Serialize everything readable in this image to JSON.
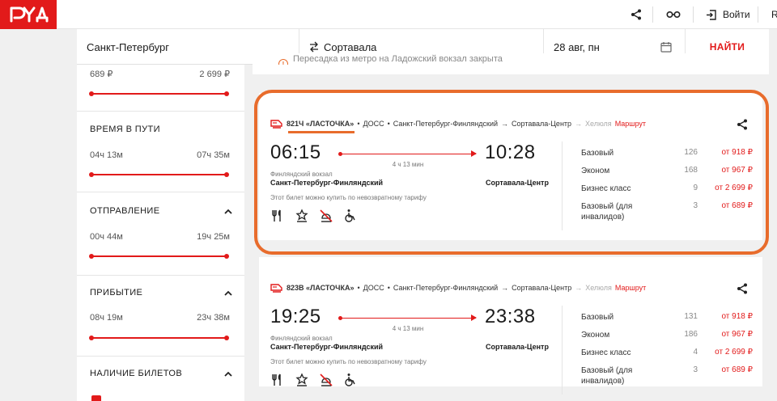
{
  "header": {
    "logo_text": "РЖД",
    "login_label": "Войти",
    "overflow_letter": "R"
  },
  "search": {
    "from": "Санкт-Петербург",
    "to": "Сортавала",
    "date": "28 авг, пн",
    "find_label": "НАЙТИ"
  },
  "filters": {
    "price": {
      "min": "689 ₽",
      "max": "2 699 ₽"
    },
    "travel_time": {
      "title": "ВРЕМЯ В ПУТИ",
      "min": "04ч 13м",
      "max": "07ч 35м"
    },
    "departure": {
      "title": "ОТПРАВЛЕНИЕ",
      "min": "00ч 44м",
      "max": "19ч 25м"
    },
    "arrival": {
      "title": "ПРИБЫТИЕ",
      "min": "08ч 19м",
      "max": "23ч 38м"
    },
    "availability": {
      "title": "НАЛИЧИЕ БИЛЕТОВ"
    }
  },
  "notice": "Пересадка из метро на Ладожский вокзал закрыта",
  "trains": [
    {
      "number": "821Ч «ЛАСТОЧКА»",
      "carrier": "ДОСС",
      "route_from": "Санкт-Петербург-Финляндский",
      "arrow": "→",
      "route_to": "Сортавала-Центр",
      "extra_arrow": "→",
      "extra_stop": "Хелюля",
      "route_link": "Маршрут",
      "dot": "•",
      "dep_time": "06:15",
      "arr_time": "10:28",
      "duration": "4 ч 13 мин",
      "dep_station_sub": "Финляндский вокзал",
      "dep_station": "Санкт-Петербург-Финляндский",
      "arr_station": "Сортавала-Центр",
      "tariff_note": "Этот билет можно купить по невозвратному тарифу",
      "classes": [
        {
          "name": "Базовый",
          "count": "126",
          "price": "от 918 ₽"
        },
        {
          "name": "Эконом",
          "count": "168",
          "price": "от 967 ₽"
        },
        {
          "name": "Бизнес класс",
          "count": "9",
          "price": "от 2 699 ₽"
        },
        {
          "name": "Базовый (для инвалидов)",
          "count": "3",
          "price": "от 689 ₽"
        }
      ]
    },
    {
      "number": "823В «ЛАСТОЧКА»",
      "carrier": "ДОСС",
      "route_from": "Санкт-Петербург-Финляндский",
      "arrow": "→",
      "route_to": "Сортавала-Центр",
      "extra_arrow": "→",
      "extra_stop": "Хелюля",
      "route_link": "Маршрут",
      "dot": "•",
      "dep_time": "19:25",
      "arr_time": "23:38",
      "duration": "4 ч 13 мин",
      "dep_station_sub": "Финляндский вокзал",
      "dep_station": "Санкт-Петербург-Финляндский",
      "arr_station": "Сортавала-Центр",
      "tariff_note": "Этот билет можно купить по невозвратному тарифу",
      "classes": [
        {
          "name": "Базовый",
          "count": "131",
          "price": "от 918 ₽"
        },
        {
          "name": "Эконом",
          "count": "186",
          "price": "от 967 ₽"
        },
        {
          "name": "Бизнес класс",
          "count": "4",
          "price": "от 2 699 ₽"
        },
        {
          "name": "Базовый (для инвалидов)",
          "count": "3",
          "price": "от 689 ₽"
        }
      ]
    }
  ],
  "colors": {
    "brand_red": "#e21a1a",
    "highlight_orange": "#e86c2c"
  }
}
